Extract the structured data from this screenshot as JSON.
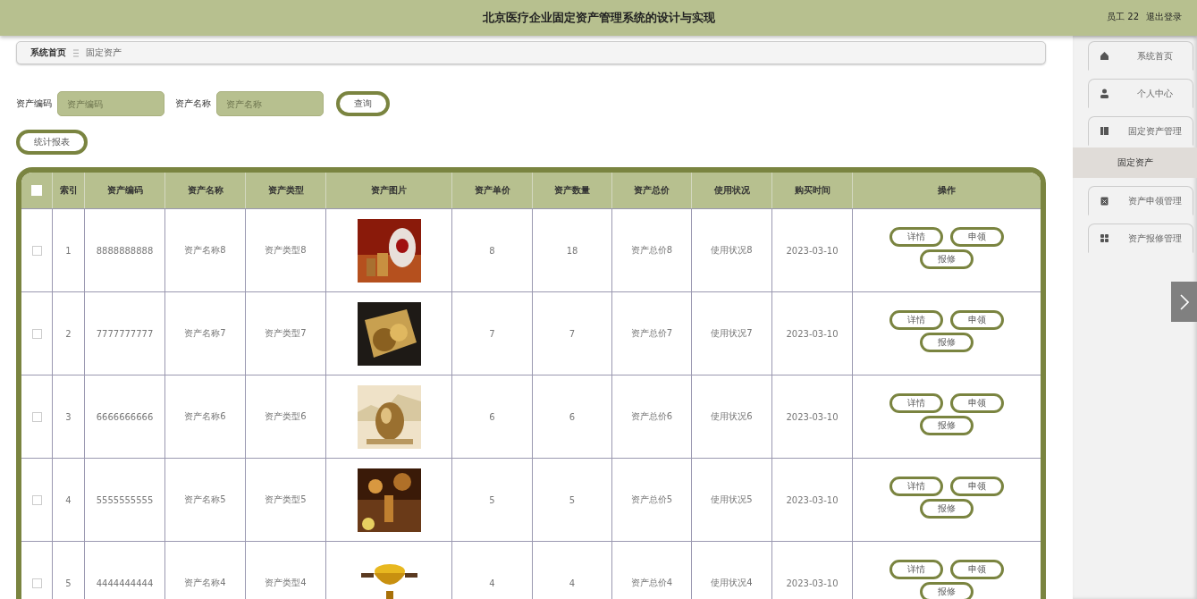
{
  "header": {
    "title": "北京医疗企业固定资产管理系统的设计与实现",
    "user": "员工 22",
    "logout": "退出登录"
  },
  "breadcrumb": [
    "系统首页",
    "固定资产"
  ],
  "search": {
    "fields": [
      {
        "label": "资产编码",
        "placeholder": "资产编码"
      },
      {
        "label": "资产名称",
        "placeholder": "资产名称"
      }
    ],
    "button": "查询"
  },
  "report_button": "统计报表",
  "table": {
    "select_all_checked": false,
    "columns": [
      "索引",
      "资产编码",
      "资产名称",
      "资产类型",
      "资产图片",
      "资产单价",
      "资产数量",
      "资产总价",
      "使用状况",
      "购买时间",
      "操作"
    ],
    "rows": [
      {
        "checked": false,
        "index": "1",
        "code": "8888888888",
        "name": "资产名称8",
        "type": "资产类型8",
        "price": "8",
        "quantity": "18",
        "total": "资产总价8",
        "status": "使用状况8",
        "date": "2023-03-10",
        "actions": [
          "详情",
          "申领",
          "报修"
        ]
      },
      {
        "checked": false,
        "index": "2",
        "code": "7777777777",
        "name": "资产名称7",
        "type": "资产类型7",
        "price": "7",
        "quantity": "7",
        "total": "资产总价7",
        "status": "使用状况7",
        "date": "2023-03-10",
        "actions": [
          "详情",
          "申领",
          "报修"
        ]
      },
      {
        "checked": false,
        "index": "3",
        "code": "6666666666",
        "name": "资产名称6",
        "type": "资产类型6",
        "price": "6",
        "quantity": "6",
        "total": "资产总价6",
        "status": "使用状况6",
        "date": "2023-03-10",
        "actions": [
          "详情",
          "申领",
          "报修"
        ]
      },
      {
        "checked": false,
        "index": "4",
        "code": "5555555555",
        "name": "资产名称5",
        "type": "资产类型5",
        "price": "5",
        "quantity": "5",
        "total": "资产总价5",
        "status": "使用状况5",
        "date": "2023-03-10",
        "actions": [
          "详情",
          "申领",
          "报修"
        ]
      },
      {
        "checked": false,
        "index": "5",
        "code": "4444444444",
        "name": "资产名称4",
        "type": "资产类型4",
        "price": "4",
        "quantity": "4",
        "total": "资产总价4",
        "status": "使用状况4",
        "date": "2023-03-10",
        "actions": [
          "详情",
          "申领",
          "报修"
        ]
      }
    ]
  },
  "sidebar": {
    "items": [
      {
        "label": "系统首页",
        "selected": false
      },
      {
        "label": "个人中心",
        "selected": false
      },
      {
        "label": "固定资产管理",
        "selected": false,
        "children": [
          {
            "label": "固定资产",
            "selected": true
          }
        ]
      },
      {
        "label": "资产申领管理",
        "selected": false
      },
      {
        "label": "资产报修管理",
        "selected": false
      }
    ]
  }
}
